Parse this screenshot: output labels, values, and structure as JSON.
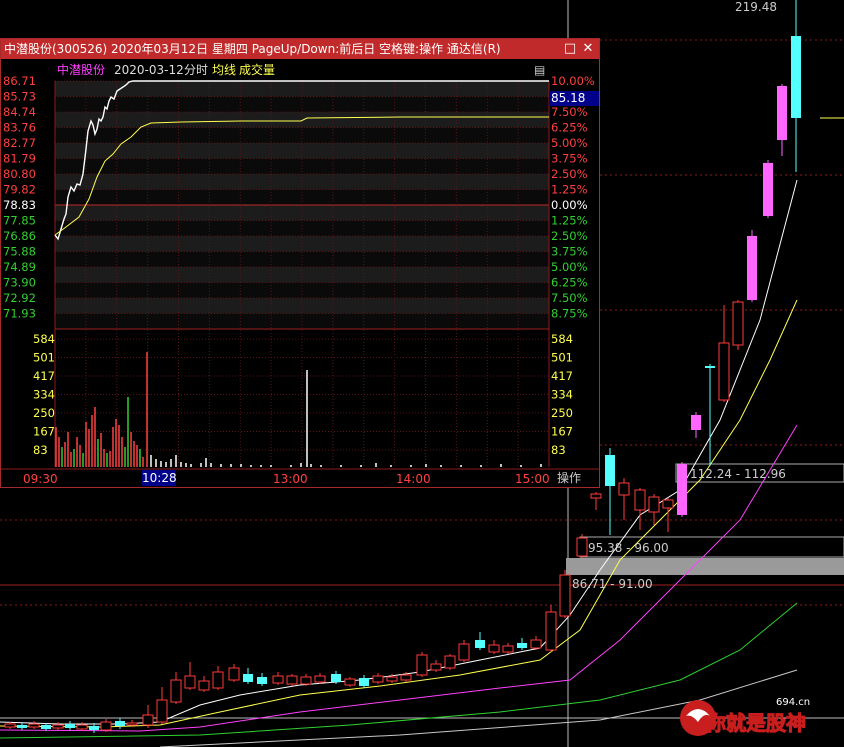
{
  "window": {
    "title": "中潜股份(300526) 2020年03月12日 星期四 PageUp/Down:前后日 空格键:操作 通达信(R)",
    "maximize_glyph": "□",
    "close_glyph": "✕"
  },
  "header": {
    "stock_name": "中潜股份",
    "date": "2020-03-12",
    "chart_label": "分时",
    "avg_label": "均线",
    "volume_label": "成交量",
    "menu_glyph": "▤"
  },
  "price_axis_left": [
    "86.71",
    "85.73",
    "84.74",
    "83.76",
    "82.77",
    "81.79",
    "80.80",
    "79.82",
    "78.83",
    "77.85",
    "76.86",
    "75.88",
    "74.89",
    "73.90",
    "72.92",
    "71.93"
  ],
  "pct_axis_right": [
    "10.00%",
    "8.75%",
    "7.50%",
    "6.25%",
    "5.00%",
    "3.75%",
    "2.50%",
    "1.25%",
    "0.00%",
    "1.25%",
    "2.50%",
    "3.75%",
    "5.00%",
    "6.25%",
    "7.50%",
    "8.75%"
  ],
  "volume_axis": [
    "584",
    "501",
    "417",
    "334",
    "250",
    "167",
    "83"
  ],
  "time_axis": [
    "09:30",
    "13:00",
    "14:00",
    "15:00"
  ],
  "highlight_time": "10:28",
  "current_price": "85.18",
  "operate_label": "操作",
  "top_price": "219.48",
  "ranges": {
    "upper": "112.24 - 112.96",
    "middle": "95.38 - 96.00",
    "lower": "86.71 - 91.00"
  },
  "colors": {
    "up": "#ff3c3c",
    "down": "#54ffff",
    "up_fill": "#ff66ff",
    "ma5": "#ffffff",
    "ma10": "#ffff50",
    "ma20": "#ff40ff",
    "ma60": "#30d030",
    "title_bg": "#c02a2a",
    "highlight": "#00008b"
  },
  "watermark": {
    "site": "694.cn",
    "slogan": "你就是股神"
  }
}
